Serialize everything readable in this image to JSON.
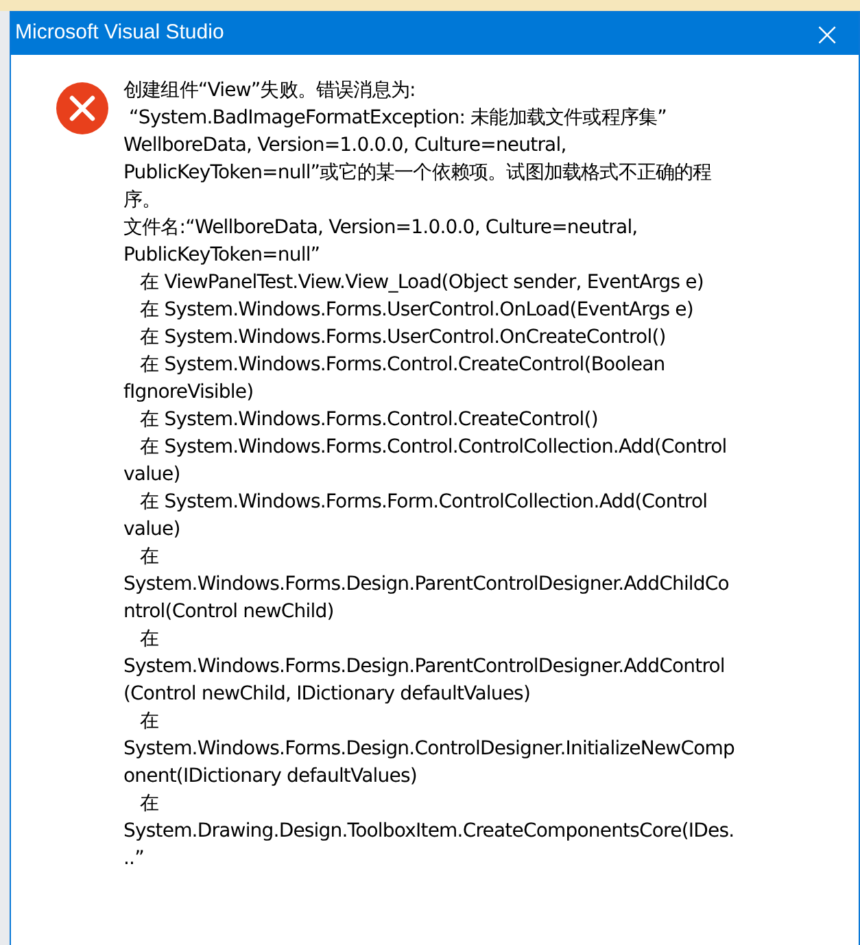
{
  "window": {
    "title": "Microsoft Visual Studio",
    "close": "×"
  },
  "message": {
    "kind": "error",
    "lines": [
      "创建组件“View”失败。错误消息为:",
      " “System.BadImageFormatException: 未能加载文件或程序集”",
      "WellboreData, Version=1.0.0.0, Culture=neutral,",
      "PublicKeyToken=null”或它的某一个依赖项。试图加载格式不正确的程",
      "序。",
      "文件名:“WellboreData, Version=1.0.0.0, Culture=neutral,",
      "PublicKeyToken=null”",
      "   在 ViewPanelTest.View.View_Load(Object sender, EventArgs e)",
      "   在 System.Windows.Forms.UserControl.OnLoad(EventArgs e)",
      "   在 System.Windows.Forms.UserControl.OnCreateControl()",
      "   在 System.Windows.Forms.Control.CreateControl(Boolean",
      "fIgnoreVisible)",
      "   在 System.Windows.Forms.Control.CreateControl()",
      "   在 System.Windows.Forms.Control.ControlCollection.Add(Control",
      "value)",
      "   在 System.Windows.Forms.Form.ControlCollection.Add(Control",
      "value)",
      "   在",
      "System.Windows.Forms.Design.ParentControlDesigner.AddChildCo",
      "ntrol(Control newChild)",
      "   在",
      "System.Windows.Forms.Design.ParentControlDesigner.AddControl",
      "(Control newChild, IDictionary defaultValues)",
      "   在",
      "System.Windows.Forms.Design.ControlDesigner.InitializeNewComp",
      "onent(IDictionary defaultValues)",
      "   在",
      "System.Drawing.Design.ToolboxItem.CreateComponentsCore(IDes.",
      "..”"
    ]
  }
}
